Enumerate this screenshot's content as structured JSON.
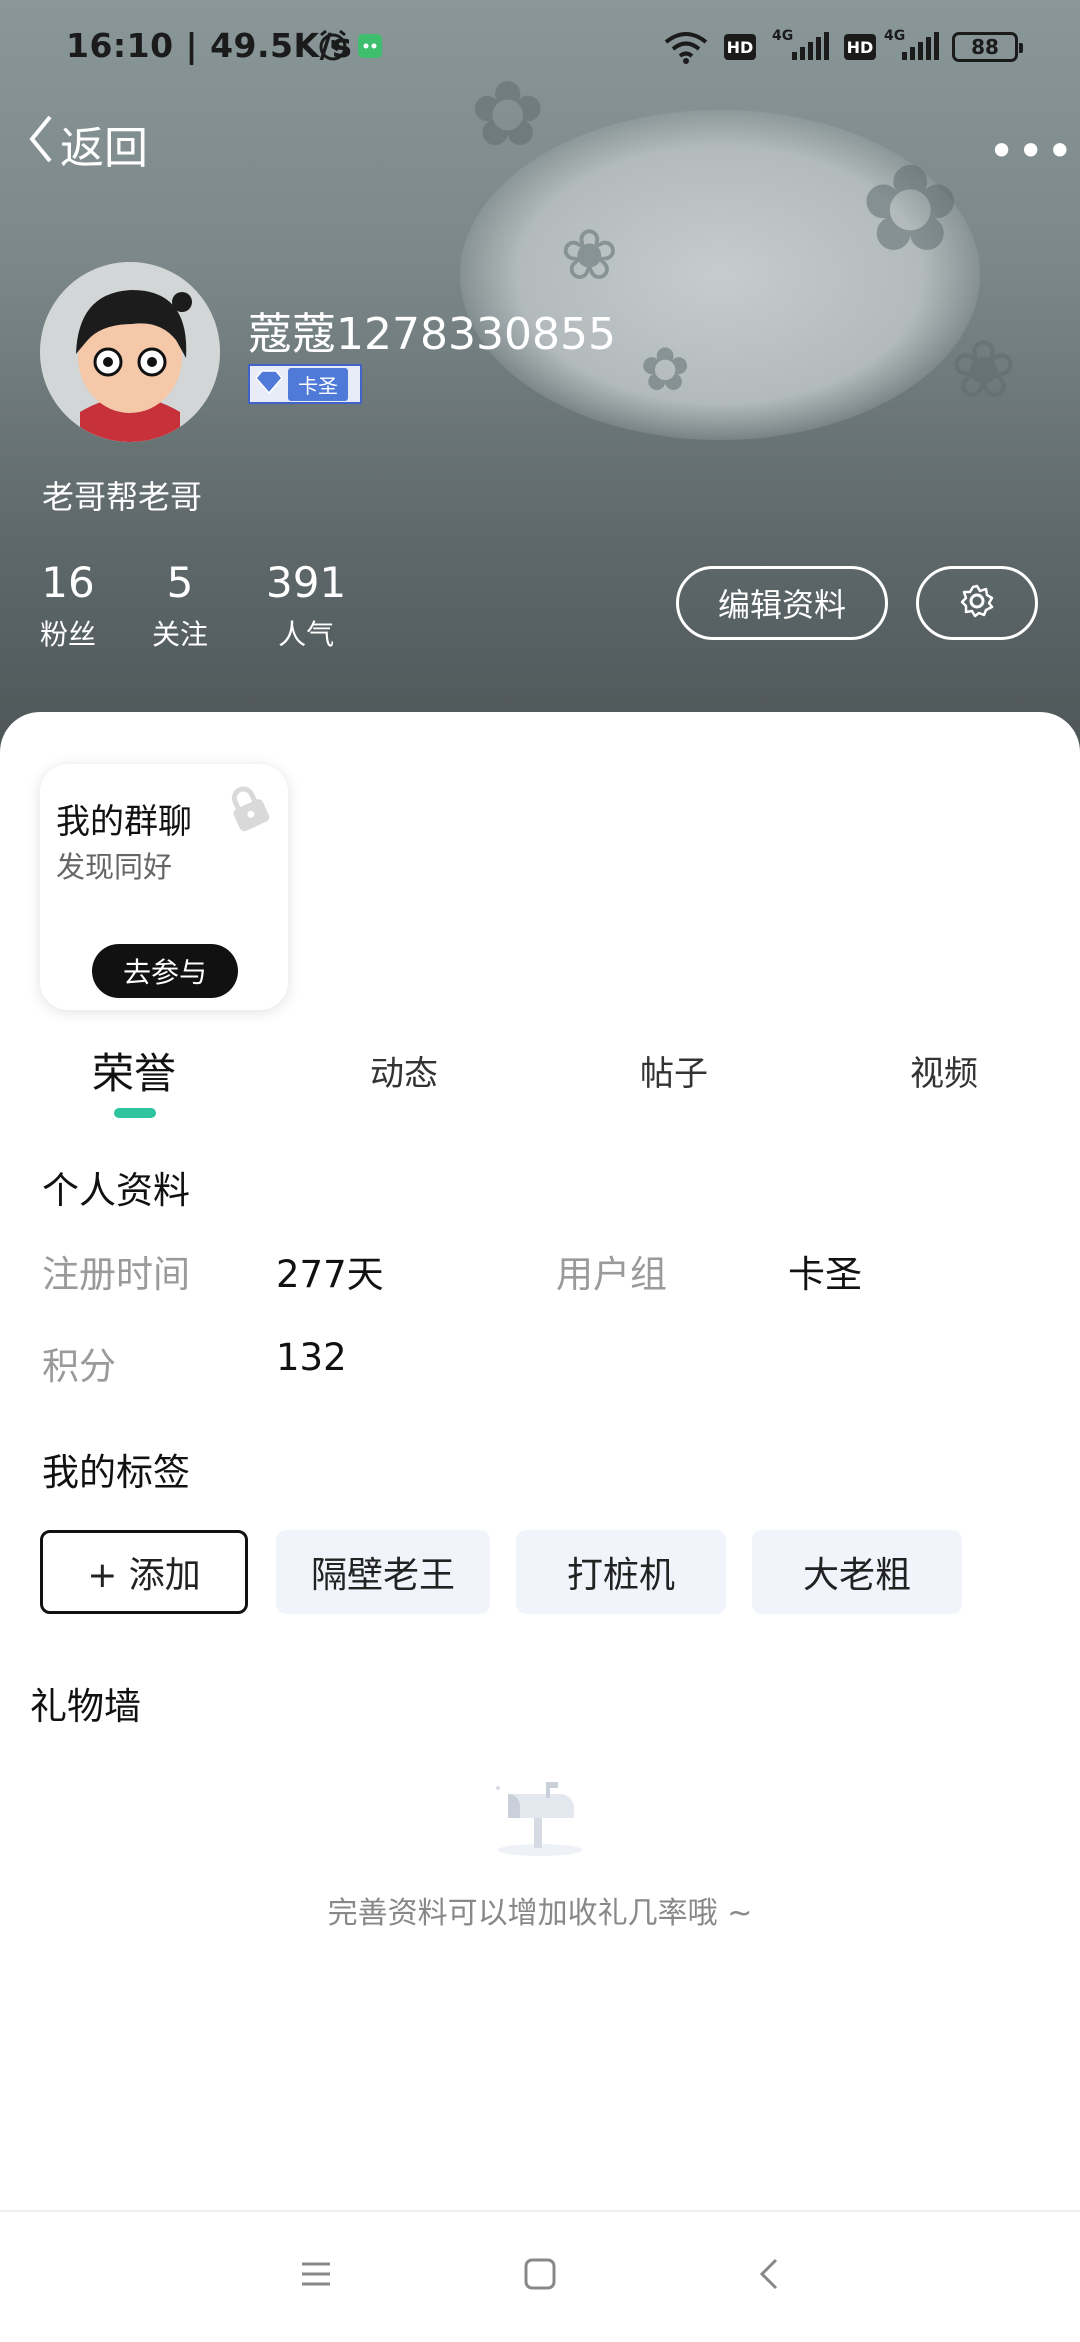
{
  "status_bar": {
    "time_speed": "16:10 | 49.5K/s",
    "net_label_1": "4G",
    "net_label_2": "4G",
    "hd_1": "HD",
    "hd_2": "HD",
    "battery": "88"
  },
  "header": {
    "back_label": "返回",
    "more_label": "•••"
  },
  "profile": {
    "username": "蔻蔻1278330855",
    "badge": "卡圣",
    "signature": "老哥帮老哥",
    "stats": [
      {
        "num": "16",
        "label": "粉丝"
      },
      {
        "num": "5",
        "label": "关注"
      },
      {
        "num": "391",
        "label": "人气"
      }
    ],
    "edit_button": "编辑资料"
  },
  "group_card": {
    "title": "我的群聊",
    "subtitle": "发现同好",
    "button": "去参与"
  },
  "tabs": [
    "荣誉",
    "动态",
    "帖子",
    "视频"
  ],
  "personal_info": {
    "title": "个人资料",
    "reg_label": "注册时间",
    "reg_value": "277天",
    "group_label": "用户组",
    "group_value": "卡圣",
    "points_label": "积分",
    "points_value": "132"
  },
  "tags": {
    "title": "我的标签",
    "add": "+ 添加",
    "items": [
      "隔壁老王",
      "打桩机",
      "大老粗"
    ]
  },
  "gift_wall": {
    "title": "礼物墙",
    "empty": "完善资料可以增加收礼几率哦 ~"
  },
  "colors": {
    "accent": "#2ec4a0",
    "badge_blue": "#4f7ad8"
  }
}
